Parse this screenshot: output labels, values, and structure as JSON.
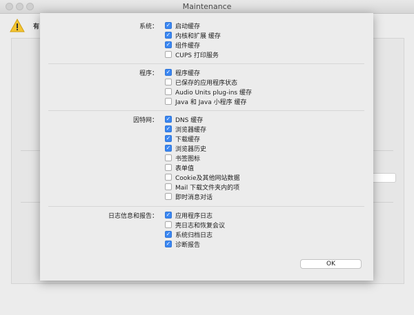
{
  "window": {
    "title": "Maintenance",
    "background_text": "有"
  },
  "groups": [
    {
      "label": "系统：",
      "items": [
        {
          "label": "启动缓存",
          "checked": true
        },
        {
          "label": "内核和扩展 缓存",
          "checked": true
        },
        {
          "label": "组件缓存",
          "checked": true
        },
        {
          "label": "CUPS 打印服务",
          "checked": false
        }
      ]
    },
    {
      "label": "程序：",
      "items": [
        {
          "label": "程序缓存",
          "checked": true
        },
        {
          "label": "已保存的应用程序状态",
          "checked": false
        },
        {
          "label": "Audio Units plug-ins 缓存",
          "checked": false
        },
        {
          "label": "Java 和 Java 小程序 缓存",
          "checked": false
        }
      ]
    },
    {
      "label": "因特网：",
      "items": [
        {
          "label": "DNS 缓存",
          "checked": true
        },
        {
          "label": "浏览器缓存",
          "checked": true
        },
        {
          "label": "下载缓存",
          "checked": true
        },
        {
          "label": "浏览器历史",
          "checked": true
        },
        {
          "label": "书签图标",
          "checked": false
        },
        {
          "label": "表单值",
          "checked": false
        },
        {
          "label": "Cookie及其他网站数据",
          "checked": false
        },
        {
          "label": "Mail 下载文件夹内的项",
          "checked": false
        },
        {
          "label": "即时消息对话",
          "checked": false
        }
      ]
    },
    {
      "label": "日志信息和报告：",
      "items": [
        {
          "label": "应用程序日志",
          "checked": true
        },
        {
          "label": "壳日志和恢复会议",
          "checked": false
        },
        {
          "label": "系统归档日志",
          "checked": true
        },
        {
          "label": "诊断报告",
          "checked": true
        }
      ]
    }
  ],
  "buttons": {
    "ok": "OK"
  },
  "colors": {
    "checkbox_on": "#3b87f2",
    "sheet_bg": "#ececec"
  }
}
